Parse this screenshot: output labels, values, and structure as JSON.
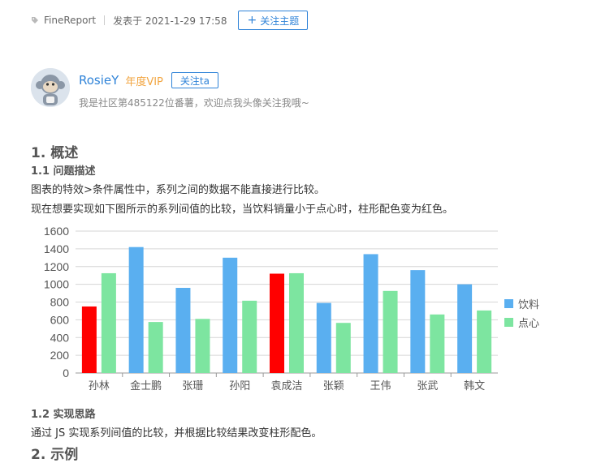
{
  "meta": {
    "category_icon": "tag-icon",
    "category": "FineReport",
    "posted": "发表于 2021-1-29 17:58",
    "follow_topic_icon": "plus-icon",
    "follow_topic_label": "关注主题"
  },
  "author": {
    "avatar": "monkey-avatar",
    "name": "RosieY",
    "badge": "年度VIP",
    "follow_label": "关注ta",
    "bio": "我是社区第485122位番薯，欢迎点我头像关注我哦~"
  },
  "article": {
    "h1_overview": "1. 概述",
    "h2_problem": "1.1 问题描述",
    "p1": "图表的特效>条件属性中，系列之间的数据不能直接进行比较。",
    "p2": "现在想要实现如下图所示的系列间值的比较，当饮料销量小于点心时，柱形配色变为红色。",
    "h2_idea": "1.2 实现思路",
    "p3": "通过 JS 实现系列间值的比较，并根据比较结果改变柱形配色。",
    "h1_example": "2. 示例"
  },
  "colors": {
    "accent": "#2f83d8",
    "vip": "#f2a541",
    "drink": "#5aaff0",
    "snack": "#7de5a0",
    "highlight": "#ff0000"
  },
  "chart_data": {
    "type": "bar",
    "categories": [
      "孙林",
      "金士鹏",
      "张珊",
      "孙阳",
      "袁成洁",
      "张颖",
      "王伟",
      "张武",
      "韩文"
    ],
    "series": [
      {
        "name": "饮料",
        "values": [
          750,
          1420,
          960,
          1300,
          1120,
          790,
          1340,
          1160,
          1000
        ]
      },
      {
        "name": "点心",
        "values": [
          1125,
          575,
          610,
          815,
          1125,
          565,
          925,
          660,
          705
        ]
      }
    ],
    "highlight_rule": "饮料 < 点心 → red",
    "ylim": [
      0,
      1600
    ],
    "yticks": [
      0,
      200,
      400,
      600,
      800,
      1000,
      1200,
      1400,
      1600
    ],
    "grid": true,
    "legend": "right"
  }
}
